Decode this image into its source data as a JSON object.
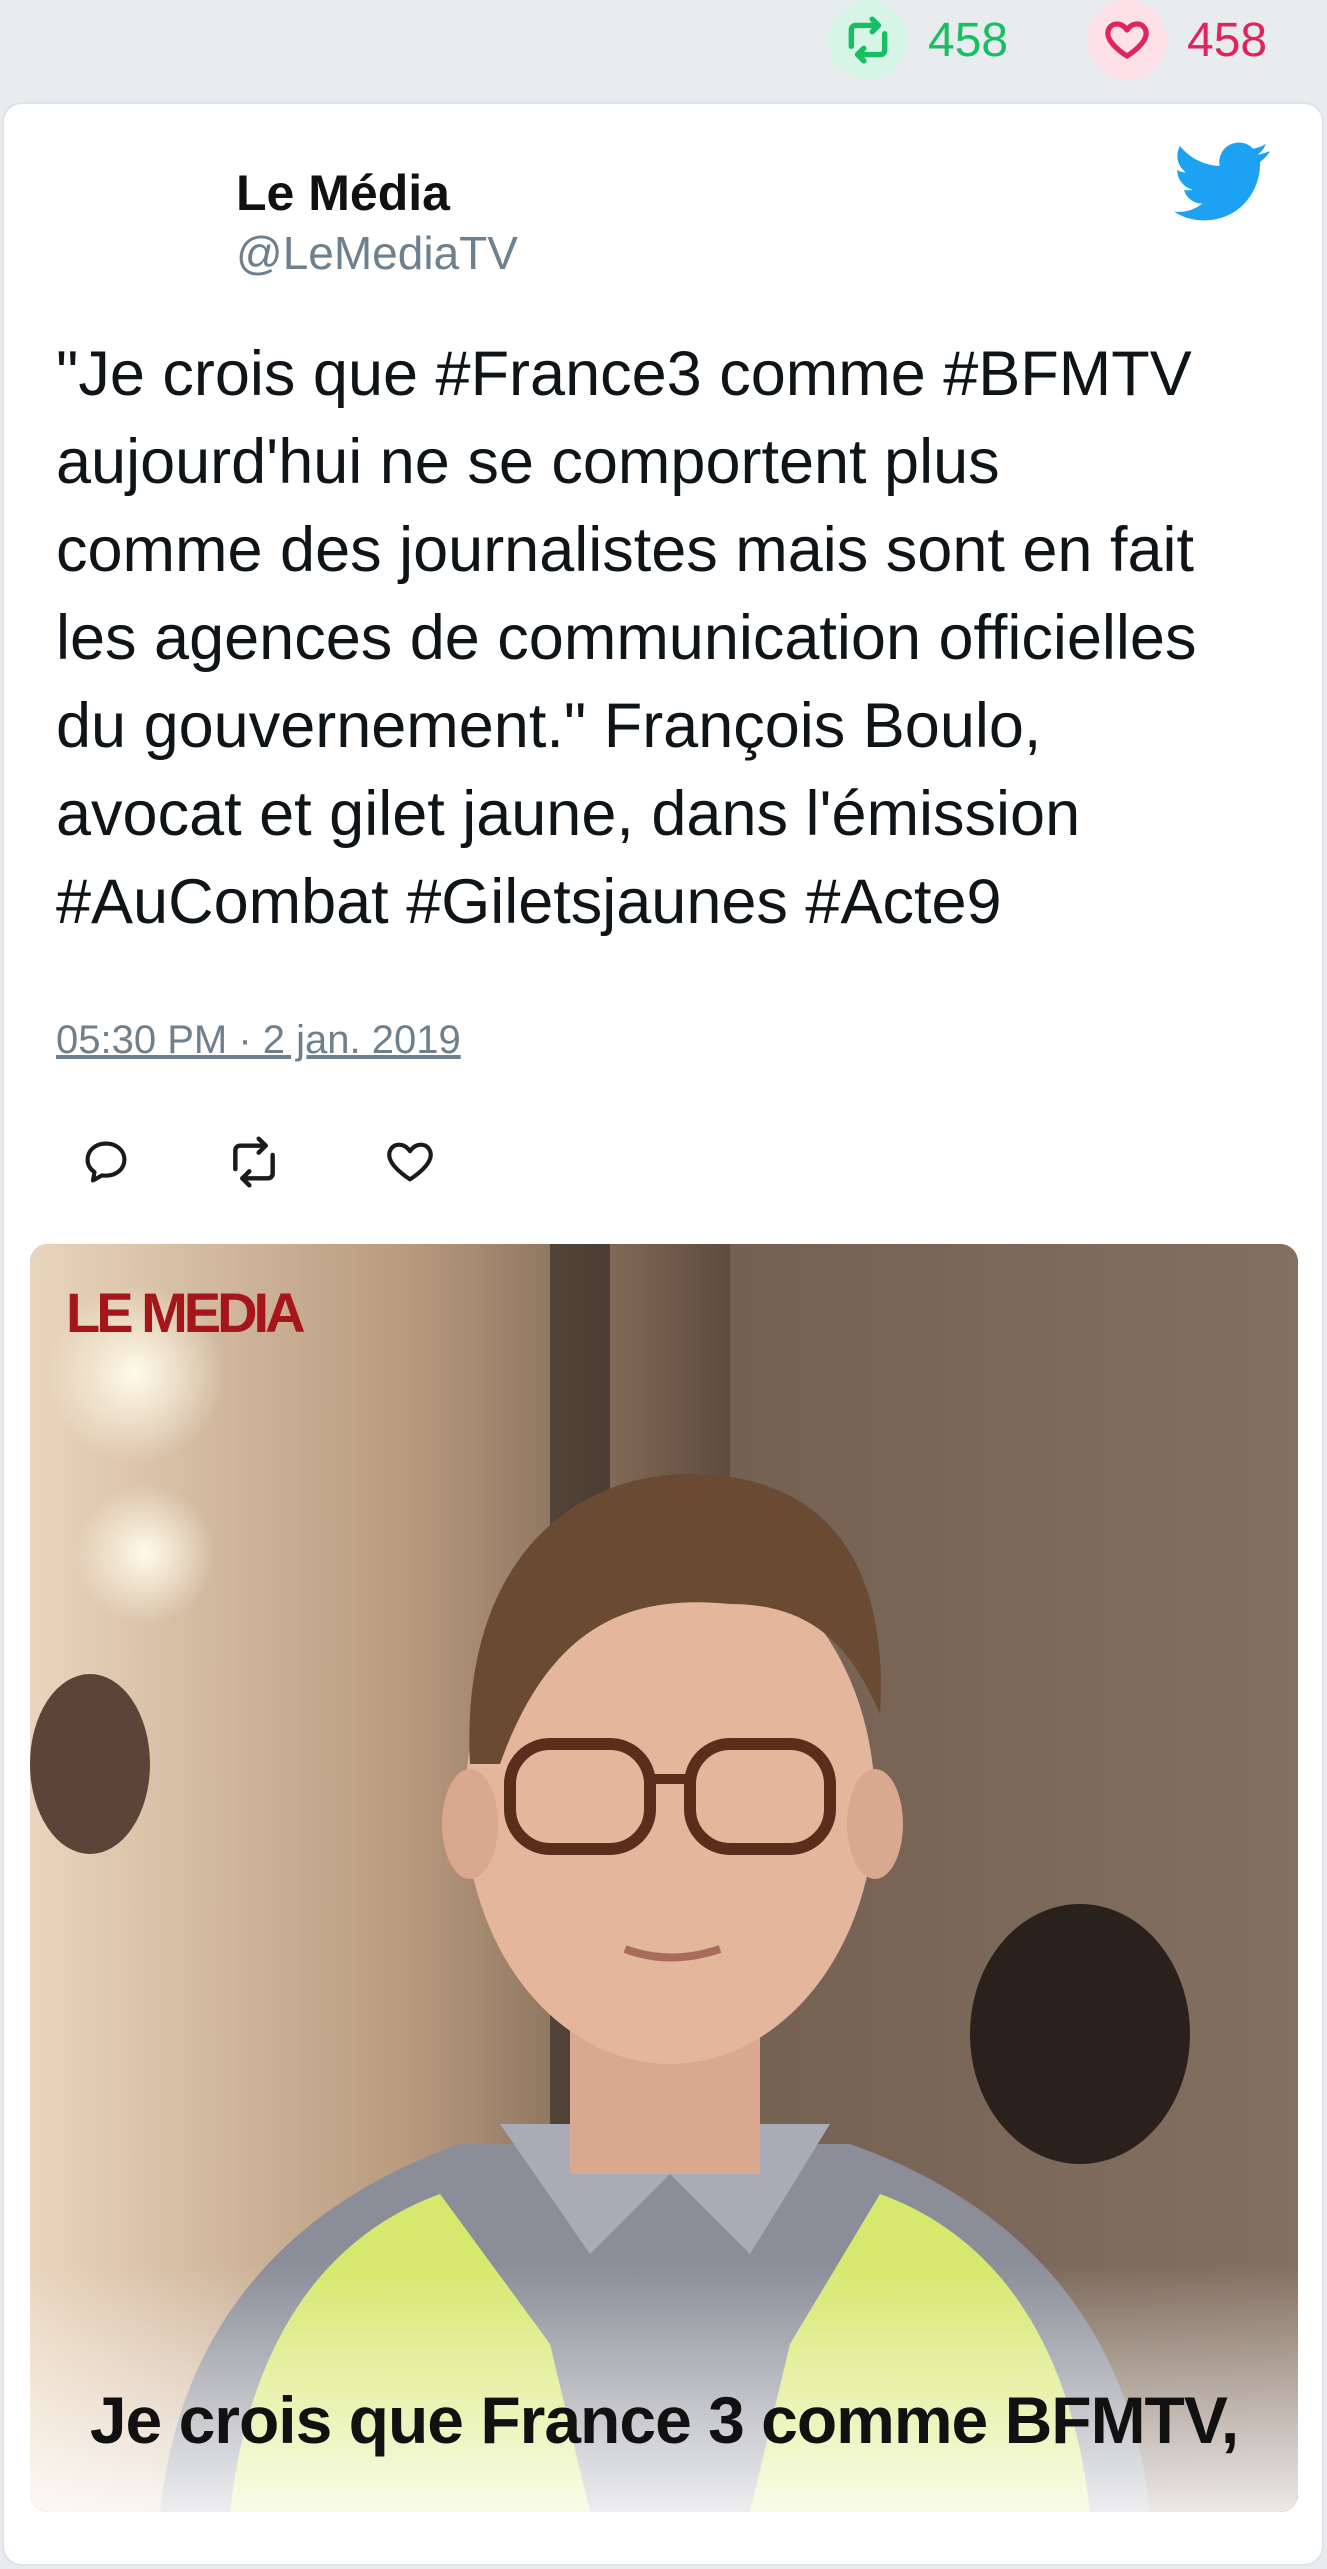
{
  "stats": {
    "retweet_count": "458",
    "like_count": "458"
  },
  "author": {
    "name": "Le Média",
    "handle": "@LeMediaTV"
  },
  "tweet": {
    "text": "\"Je crois que #France3 comme #BFMTV\naujourd'hui ne se comportent plus\ncomme des journalistes mais sont en fait\nles agences de communication officielles\ndu gouvernement.\" François Boulo,\navocat et gilet jaune, dans l'émission\n#AuCombat #Giletsjaunes #Acte9",
    "timestamp": "05:30 PM · 2 jan. 2019"
  },
  "media": {
    "logo_text": "LE MÉDIA",
    "caption": "Je crois que France 3 comme BFMTV,"
  },
  "colors": {
    "retweet": "#17bf63",
    "like": "#e0245e",
    "twitter_blue": "#1da1f2",
    "muted": "#6e7f8d"
  },
  "icons": [
    "retweet-icon",
    "heart-icon",
    "twitter-bird-icon",
    "reply-icon"
  ]
}
